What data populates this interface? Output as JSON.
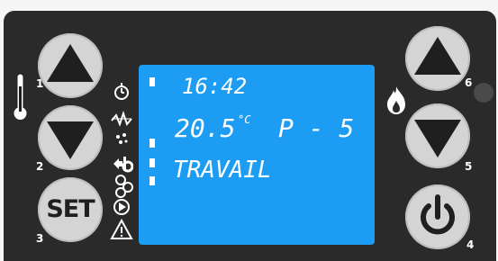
{
  "display": {
    "time": "16:42",
    "temperature": "20.5",
    "temperature_unit": "°C",
    "program": "P - 5",
    "status": "TRAVAIL"
  },
  "buttons": {
    "btn1": {
      "number": "1",
      "icon": "up-triangle-icon"
    },
    "btn2": {
      "number": "2",
      "icon": "down-triangle-icon"
    },
    "btn3": {
      "number": "3",
      "label": "SET"
    },
    "btn4": {
      "number": "4",
      "icon": "power-icon"
    },
    "btn5": {
      "number": "5",
      "icon": "down-triangle-icon"
    },
    "btn6": {
      "number": "6",
      "icon": "up-triangle-icon"
    }
  },
  "indicators": [
    "thermometer-icon",
    "clock-icon",
    "heater-icon",
    "fan-icon",
    "pump-icon",
    "play-icon",
    "warning-icon",
    "flame-icon",
    "led-indicator"
  ],
  "colors": {
    "panel": "#2a2a2a",
    "lcd": "#1c9df3",
    "button": "#d4d4d4",
    "symbol": "#1f1f1f"
  }
}
